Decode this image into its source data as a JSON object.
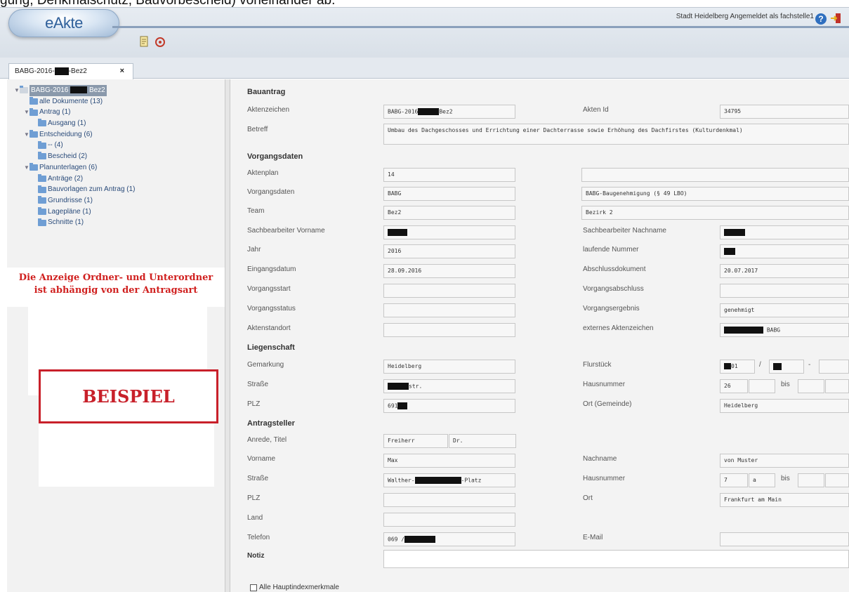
{
  "caption": "gung, Denkmalschutz, Bauvorbescheid) voneinander ab.",
  "header": {
    "logo": "eAkte",
    "status": "Stadt Heidelberg   Angemeldet als fachstelle1"
  },
  "tab": {
    "label_a": "BABG-2016-",
    "label_b": "-Bez2",
    "close": "×"
  },
  "tree": {
    "root_a": "BABG-2016",
    "root_b": "Bez2",
    "items": [
      "alle Dokumente (13)",
      "Antrag (1)",
      "Ausgang (1)",
      "Entscheidung (6)",
      "-- (4)",
      "Bescheid (2)",
      "Planunterlagen (6)",
      "Anträge (2)",
      "Bauvorlagen zum Antrag (1)",
      "Grundrisse (1)",
      "Lagepläne (1)",
      "Schnitte (1)"
    ]
  },
  "note": {
    "line1": "Die Anzeige Ordner- und Unterordner",
    "line2": "ist abhängig von der Antragsart"
  },
  "beispiel": "BEISPIEL",
  "form": {
    "sections": {
      "bauantrag": "Bauantrag",
      "vorgangsdaten": "Vorgangsdaten",
      "liegenschaft": "Liegenschaft",
      "antragsteller": "Antragsteller"
    },
    "labels": {
      "aktenzeichen": "Aktenzeichen",
      "akten_id": "Akten Id",
      "betreff": "Betreff",
      "aktenplan": "Aktenplan",
      "vorgangsdaten": "Vorgangsdaten",
      "team": "Team",
      "sb_vorname": "Sachbearbeiter Vorname",
      "sb_nachname": "Sachbearbeiter Nachname",
      "jahr": "Jahr",
      "laufende_nummer": "laufende Nummer",
      "eingangsdatum": "Eingangsdatum",
      "abschlussdokument": "Abschlussdokument",
      "vorgangsstart": "Vorgangsstart",
      "vorgangsabschluss": "Vorgangsabschluss",
      "vorgangsstatus": "Vorgangsstatus",
      "vorgangsergebnis": "Vorgangsergebnis",
      "aktenstandort": "Aktenstandort",
      "ext_aktenzeichen": "externes Aktenzeichen",
      "gemarkung": "Gemarkung",
      "flurstueck": "Flurstück",
      "strasse": "Straße",
      "hausnummer": "Hausnummer",
      "bis": "bis",
      "plz": "PLZ",
      "ort_gemeinde": "Ort (Gemeinde)",
      "anrede_titel": "Anrede, Titel",
      "vorname": "Vorname",
      "nachname": "Nachname",
      "ort": "Ort",
      "land": "Land",
      "telefon": "Telefon",
      "email": "E-Mail",
      "notiz": "Notiz"
    },
    "values": {
      "aktenzeichen_a": "BABG-2016",
      "aktenzeichen_b": "Bez2",
      "akten_id": "34795",
      "betreff": "Umbau des Dachgeschosses und Errichtung einer Dachterrasse sowie Erhöhung des Dachfirstes (Kulturdenkmal)",
      "aktenplan": "14",
      "vorgangsdaten": "BABG",
      "vorgangsdaten_desc": "BABG-Baugenehmigung (§ 49 LBO)",
      "team": "Bez2",
      "team_desc": "Bezirk 2",
      "jahr": "2016",
      "eingangsdatum": "28.09.2016",
      "abschlussdokument": "20.07.2017",
      "vorgangsergebnis": "genehmigt",
      "ext_aktenzeichen": "BABG",
      "gemarkung": "Heidelberg",
      "flurstueck_a": "01",
      "flurstueck_sep": "/",
      "flurstueck_sep2": "-",
      "strasse_suffix": "str.",
      "hausnummer": "26",
      "plz": "691",
      "ort_gemeinde": "Heidelberg",
      "anrede": "Freiherr",
      "titel": "Dr.",
      "vorname": "Max",
      "nachname": "von Muster",
      "as_strasse_a": "Walther-",
      "as_strasse_b": "-Platz",
      "as_hausnummer": "7",
      "as_hausnummer_zusatz": "a",
      "as_ort": "Frankfurt am Main",
      "telefon": "069 /"
    },
    "checkbox_label": "Alle Hauptindexmerkmale"
  },
  "colors": {
    "accent": "#2e5f9a",
    "note_red": "#d0201f",
    "beispiel_red": "#c8202a"
  }
}
